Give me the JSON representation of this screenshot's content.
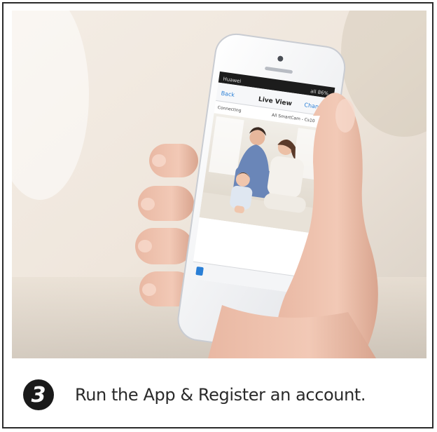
{
  "photo": {
    "phone_screen": {
      "status_left": "Huawei",
      "status_right": "all 86%",
      "nav_back": "Back",
      "nav_title": "Live View",
      "nav_right": "Channel",
      "info_left": "Connecting",
      "info_right": "All SmartCam - Cs10"
    }
  },
  "caption": {
    "step_number": "3",
    "text": "Run the App & Register an account."
  },
  "colors": {
    "frame": "#2b2b2b",
    "app_blue": "#2a7fd6",
    "badge": "#1a1a1a"
  }
}
